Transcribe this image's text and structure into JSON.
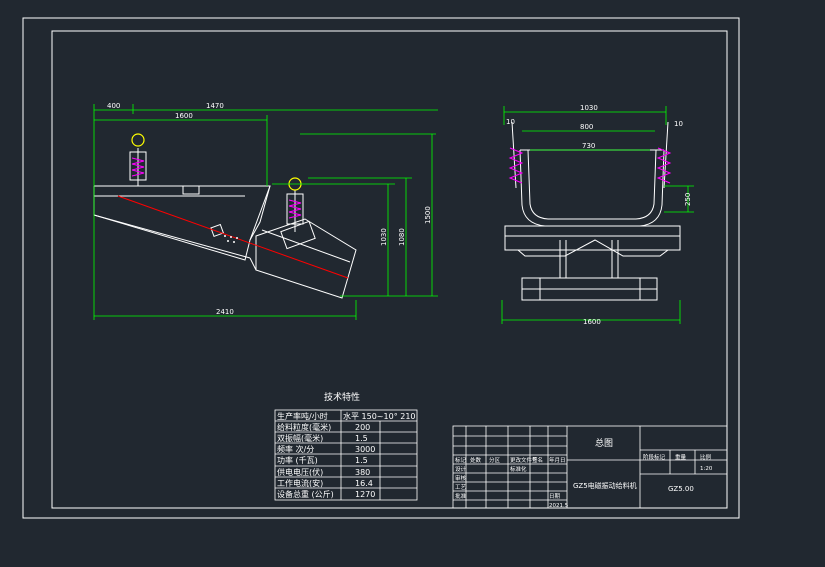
{
  "colors": {
    "background": "#212830",
    "line": "#ffffff",
    "dimension": "#00ff00",
    "centerline": "#ff0000",
    "spring": "#ff00ff",
    "hook": "#ffff00"
  },
  "side_view": {
    "dims": {
      "d400": "400",
      "d1470": "1470",
      "d1600": "1600",
      "d1030": "1030",
      "d1080": "1080",
      "d1500": "1500",
      "d2410": "2410"
    }
  },
  "end_view": {
    "dims": {
      "d1030": "1030",
      "d800": "800",
      "d730": "730",
      "d250": "250",
      "d1600": "1600",
      "d10_left": "10",
      "d10_right": "10"
    }
  },
  "tech_table": {
    "title": "技术特性",
    "rows": [
      {
        "label": "生产率吨/小时",
        "value": "水平 150~10° 210"
      },
      {
        "label": "给料粒度(毫米)",
        "value": "200"
      },
      {
        "label": "双振幅(毫米)",
        "value": "1.5"
      },
      {
        "label": "频率  次/分",
        "value": "3000"
      },
      {
        "label": "功率  (千瓦)",
        "value": "1.5"
      },
      {
        "label": "供电电压(伏)",
        "value": "380"
      },
      {
        "label": "工作电流(安)",
        "value": "16.4"
      },
      {
        "label": "设备总重 (公斤)",
        "value": "1270"
      }
    ]
  },
  "title_block": {
    "drawing_name": "总图",
    "product_name": "GZ5电磁振动给料机",
    "drawing_no": "GZ5.00",
    "headers": [
      "阶段标记",
      "重量",
      "比例"
    ],
    "scale": "1:20",
    "small": [
      "标记",
      "处数",
      "分区",
      "更改文件号",
      "签名",
      "年月日",
      "设计",
      "标准化",
      "审核",
      "工艺",
      "批准",
      "日期",
      "2021.5"
    ]
  }
}
